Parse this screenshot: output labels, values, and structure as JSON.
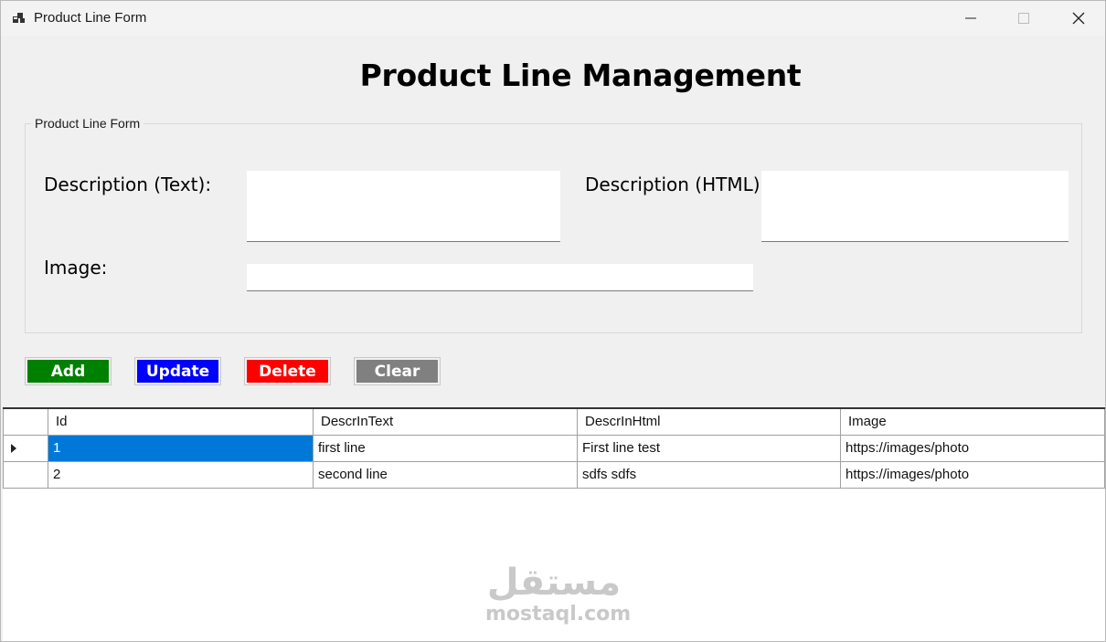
{
  "window": {
    "title": "Product Line Form",
    "icon": "app-windows-icon"
  },
  "page": {
    "title": "Product Line Management"
  },
  "form": {
    "group_label": "Product Line Form",
    "description_text_label": "Description (Text):",
    "description_text_value": "",
    "description_html_label": "Description (HTML):",
    "description_html_value": "",
    "image_label": "Image:",
    "image_value": ""
  },
  "buttons": {
    "add": "Add",
    "update": "Update",
    "delete": "Delete",
    "clear": "Clear"
  },
  "colors": {
    "add": "#008000",
    "update": "#0000ff",
    "delete": "#ff0000",
    "clear": "#808080",
    "selection": "#0078d7"
  },
  "grid": {
    "columns": [
      "Id",
      "DescrInText",
      "DescrInHtml",
      "Image"
    ],
    "rows": [
      {
        "id": "1",
        "descr_text": "first line",
        "descr_html": "First line test",
        "image": "https://images/photo",
        "selected": true
      },
      {
        "id": "2",
        "descr_text": "second line",
        "descr_html": "sdfs sdfs",
        "image": "https://images/photo",
        "selected": false
      }
    ]
  },
  "watermark": {
    "arabic": "مستقل",
    "latin": "mostaql.com"
  }
}
